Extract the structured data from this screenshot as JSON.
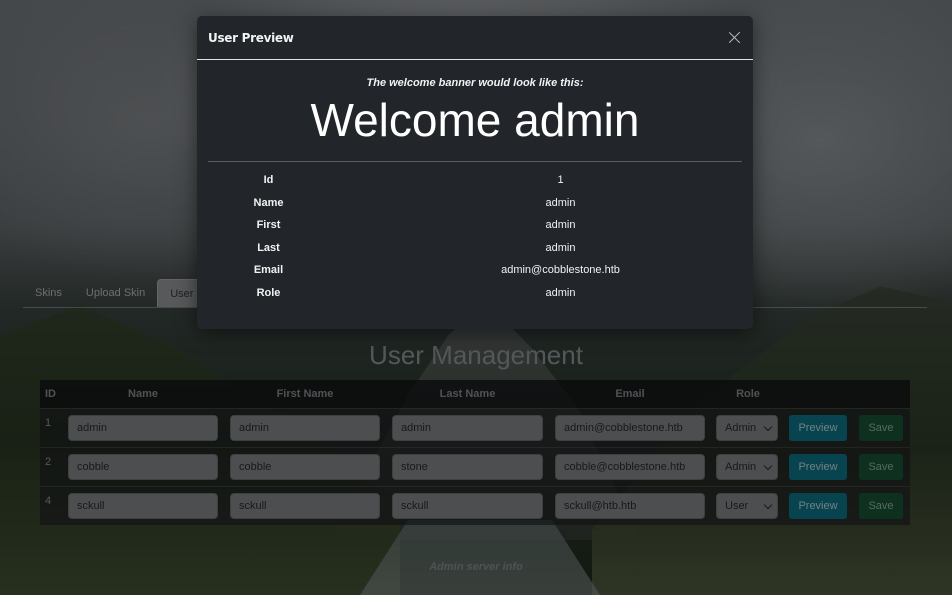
{
  "modal": {
    "title": "User Preview",
    "banner_caption": "The welcome banner would look like this:",
    "banner_text": "Welcome admin",
    "fields": [
      {
        "key": "Id",
        "value": "1"
      },
      {
        "key": "Name",
        "value": "admin"
      },
      {
        "key": "First",
        "value": "admin"
      },
      {
        "key": "Last",
        "value": "admin"
      },
      {
        "key": "Email",
        "value": "admin@cobblestone.htb"
      },
      {
        "key": "Role",
        "value": "admin"
      }
    ]
  },
  "tabs": [
    {
      "label": "Skins"
    },
    {
      "label": "Upload Skin"
    },
    {
      "label": "User"
    }
  ],
  "section_title": "User Management",
  "table": {
    "headers": {
      "id": "ID",
      "name": "Name",
      "first_name": "First Name",
      "last_name": "Last Name",
      "email": "Email",
      "role": "Role"
    },
    "rows": [
      {
        "id": "1",
        "name": "admin",
        "first": "admin",
        "last": "admin",
        "email": "admin@cobblestone.htb",
        "role": "Admin"
      },
      {
        "id": "2",
        "name": "cobble",
        "first": "cobble",
        "last": "stone",
        "email": "cobble@cobblestone.htb",
        "role": "Admin"
      },
      {
        "id": "4",
        "name": "sckull",
        "first": "sckull",
        "last": "sckull",
        "email": "sckull@htb.htb",
        "role": "User"
      }
    ],
    "preview_label": "Preview",
    "save_label": "Save"
  },
  "footer_link": "Admin server info"
}
